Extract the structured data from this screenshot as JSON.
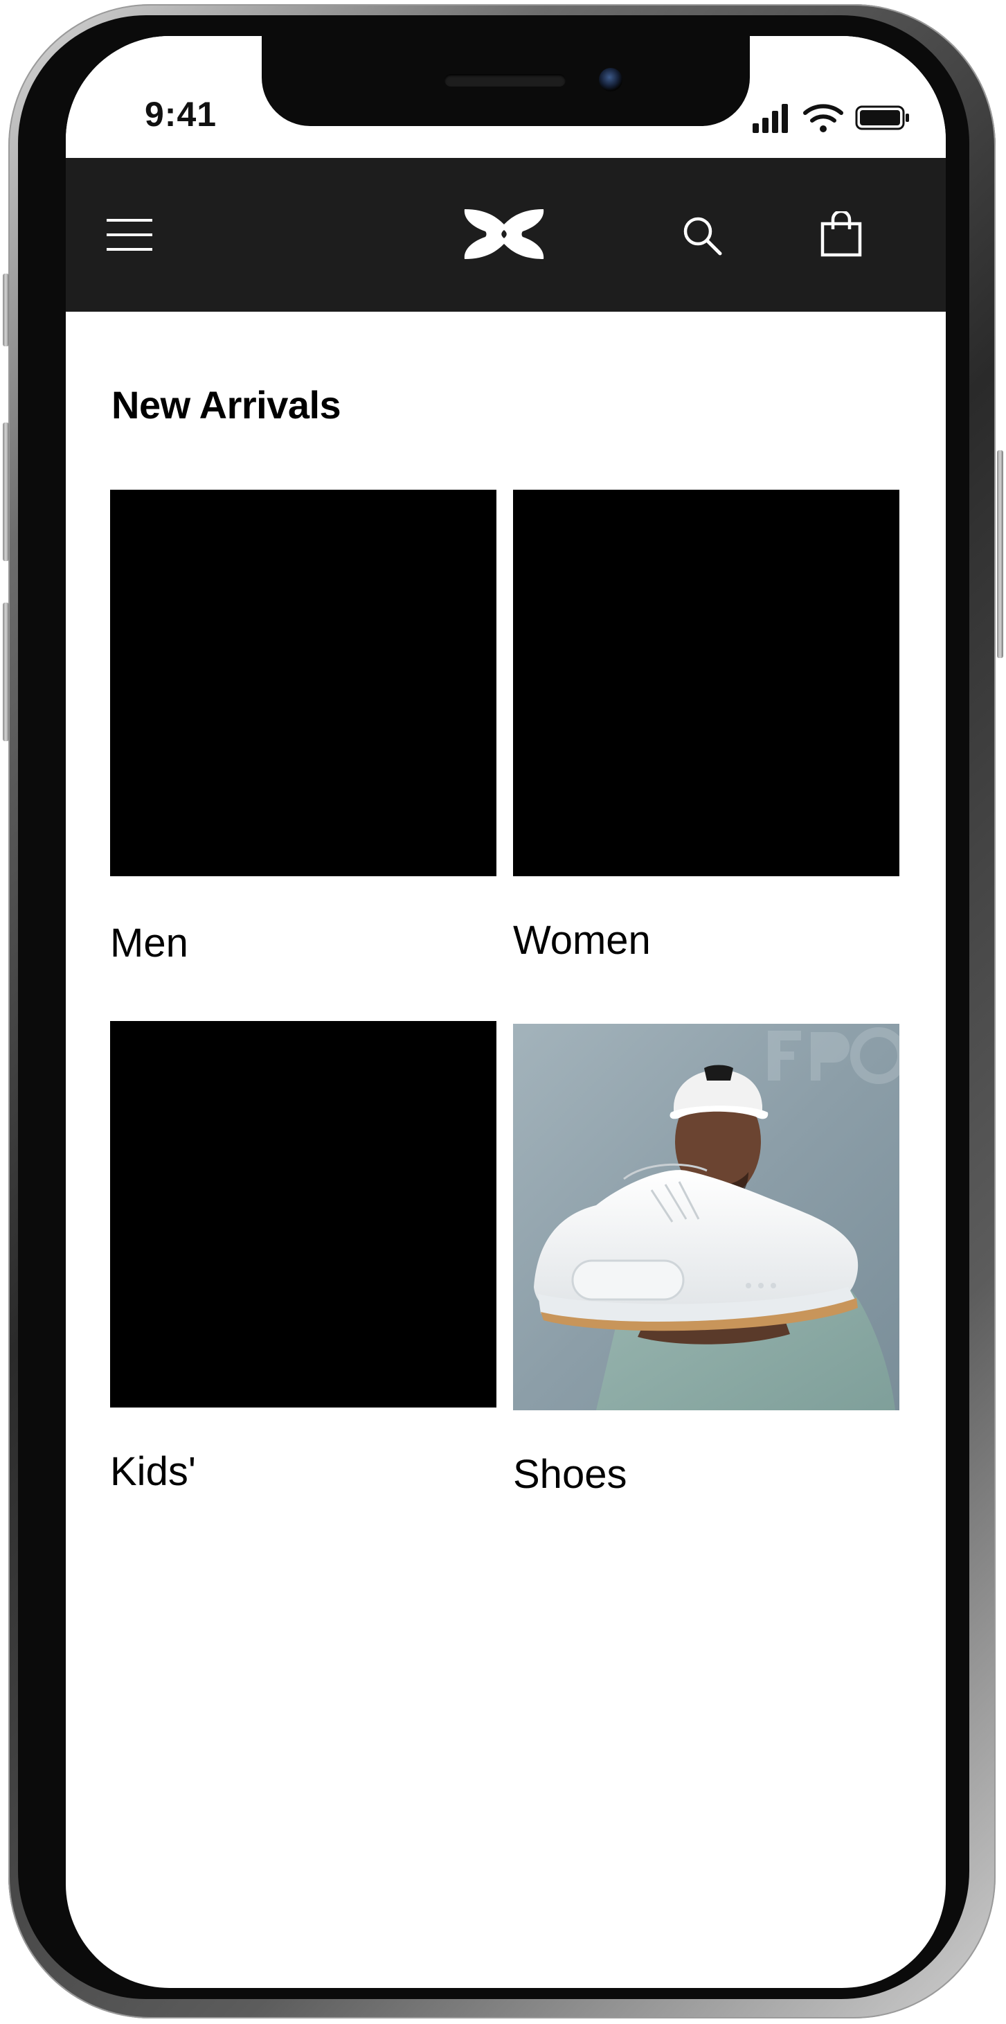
{
  "status_bar": {
    "time": "9:41",
    "icons": [
      "cellular-signal-icon",
      "wifi-icon",
      "battery-icon"
    ]
  },
  "header": {
    "background_color": "#1d1d1d",
    "icon_color": "#ffffff",
    "menu_icon": "hamburger-menu-icon",
    "logo": "under-armour-logo",
    "search_icon": "search-icon",
    "bag_icon": "shopping-bag-icon"
  },
  "main": {
    "section_title": "New Arrivals",
    "categories": [
      {
        "label": "Men",
        "image": "placeholder-black"
      },
      {
        "label": "Women",
        "image": "placeholder-black"
      },
      {
        "label": "Kids'",
        "image": "placeholder-black"
      },
      {
        "label": "Shoes",
        "image": "man-holding-white-sneaker-photo"
      }
    ]
  }
}
